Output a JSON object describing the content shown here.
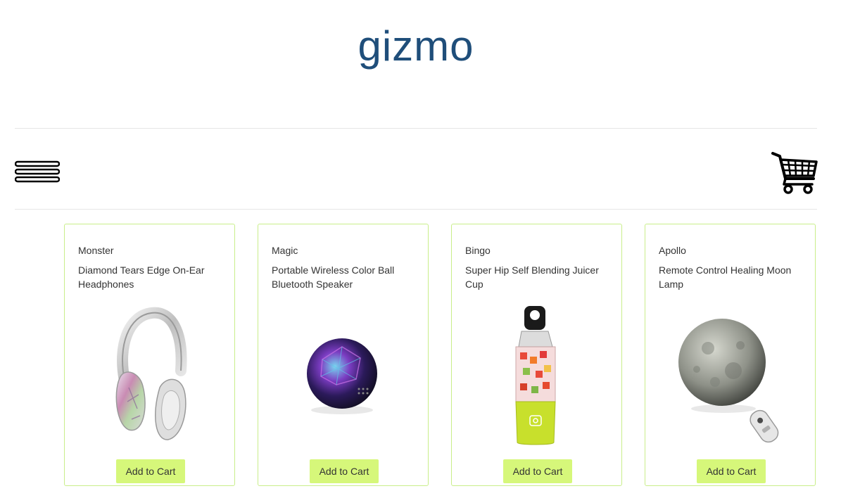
{
  "header": {
    "logo": "gizmo"
  },
  "nav": {
    "menu_icon": "hamburger-menu-icon",
    "cart_icon": "shopping-cart-icon"
  },
  "colors": {
    "logo": "#1f4e7a",
    "card_border": "#c9ee8a",
    "button_bg": "#d6f77a"
  },
  "products": [
    {
      "brand": "Monster",
      "title": "Diamond Tears Edge On-Ear Headphones",
      "image_icon": "headphones-image",
      "button_label": "Add to Cart"
    },
    {
      "brand": "Magic",
      "title": "Portable Wireless Color Ball Bluetooth Speaker",
      "image_icon": "speaker-ball-image",
      "button_label": "Add to Cart"
    },
    {
      "brand": "Bingo",
      "title": "Super Hip Self Blending Juicer Cup",
      "image_icon": "juicer-cup-image",
      "button_label": "Add to Cart"
    },
    {
      "brand": "Apollo",
      "title": "Remote Control Healing Moon Lamp",
      "image_icon": "moon-lamp-image",
      "button_label": "Add to Cart"
    }
  ]
}
